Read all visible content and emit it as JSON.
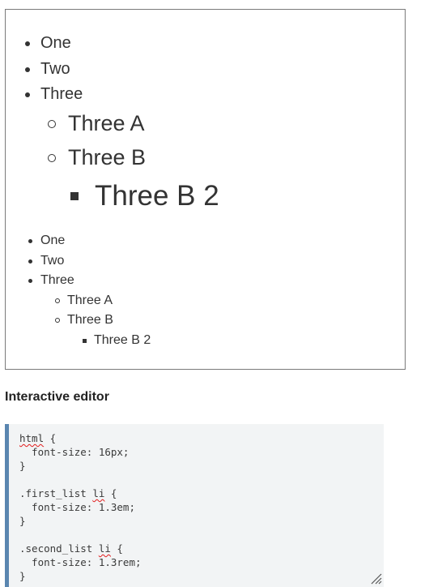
{
  "first_list": {
    "items": [
      "One",
      "Two",
      "Three"
    ],
    "nested": [
      "Three A",
      "Three B"
    ],
    "deep": [
      "Three B 2"
    ]
  },
  "second_list": {
    "items": [
      "One",
      "Two",
      "Three"
    ],
    "nested": [
      "Three A",
      "Three B"
    ],
    "deep": [
      "Three B 2"
    ]
  },
  "section_heading": "Interactive editor",
  "editor": {
    "line_1_selector": "html",
    "line_1_rest": " {",
    "line_2": "  font-size: 16px;",
    "line_3": "}",
    "line_5_selector": ".first_list ",
    "line_5_li": "li",
    "line_5_rest": " {",
    "line_6": "  font-size: 1.3em;",
    "line_7": "}",
    "line_9_selector": ".second_list ",
    "line_9_li": "li",
    "line_9_rest": " {",
    "line_10": "  font-size: 1.3rem;",
    "line_11": "}"
  },
  "icons": {
    "resize": "resize-grip-icon"
  }
}
